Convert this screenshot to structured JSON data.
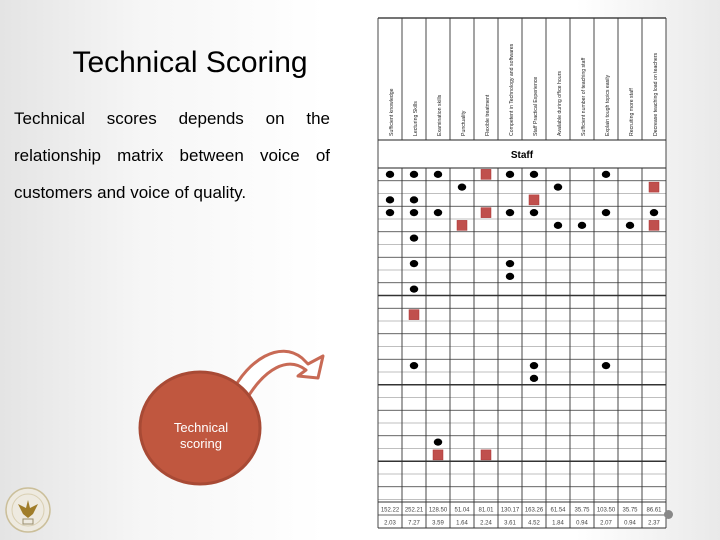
{
  "slide": {
    "title": "Technical Scoring",
    "body": "Technical scores depends on the relationship matrix between voice of customers and voice of quality.",
    "callout_label_line1": "Technical",
    "callout_label_line2": "scoring",
    "logo_icon": "university-seal-eagle-icon",
    "colors": {
      "callout_fill": "#c0573f",
      "callout_stroke": "#a84a35",
      "arrow_stroke": "#c86a55",
      "square_mark": "#c0504d",
      "dot_mark": "#000000"
    }
  },
  "matrix": {
    "group_label": "Staff",
    "columns": [
      "Sufficient knowledge",
      "Lecturing Skills",
      "Examination skills",
      "Punctuality",
      "Flexible treatment",
      "Competent in Technology and softwares",
      "Staff Practical Experience",
      "Available during office hours",
      "Sufficient number of teaching staff",
      "Explain tough topics easily",
      "Recruiting more staff",
      "Decrease teaching load on teachers"
    ],
    "row_count": 26,
    "marks": [
      {
        "row": 0,
        "col": 0,
        "type": "dot"
      },
      {
        "row": 0,
        "col": 1,
        "type": "dot"
      },
      {
        "row": 0,
        "col": 2,
        "type": "dot"
      },
      {
        "row": 0,
        "col": 4,
        "type": "square"
      },
      {
        "row": 0,
        "col": 5,
        "type": "dot"
      },
      {
        "row": 0,
        "col": 6,
        "type": "dot"
      },
      {
        "row": 0,
        "col": 9,
        "type": "dot"
      },
      {
        "row": 1,
        "col": 3,
        "type": "dot"
      },
      {
        "row": 1,
        "col": 7,
        "type": "dot"
      },
      {
        "row": 1,
        "col": 11,
        "type": "square"
      },
      {
        "row": 2,
        "col": 0,
        "type": "dot"
      },
      {
        "row": 2,
        "col": 1,
        "type": "dot"
      },
      {
        "row": 2,
        "col": 6,
        "type": "square"
      },
      {
        "row": 3,
        "col": 0,
        "type": "dot"
      },
      {
        "row": 3,
        "col": 1,
        "type": "dot"
      },
      {
        "row": 3,
        "col": 2,
        "type": "dot"
      },
      {
        "row": 3,
        "col": 4,
        "type": "square"
      },
      {
        "row": 3,
        "col": 5,
        "type": "dot"
      },
      {
        "row": 3,
        "col": 6,
        "type": "dot"
      },
      {
        "row": 3,
        "col": 9,
        "type": "dot"
      },
      {
        "row": 3,
        "col": 11,
        "type": "dot"
      },
      {
        "row": 4,
        "col": 3,
        "type": "square"
      },
      {
        "row": 4,
        "col": 7,
        "type": "dot"
      },
      {
        "row": 4,
        "col": 8,
        "type": "dot"
      },
      {
        "row": 4,
        "col": 10,
        "type": "dot"
      },
      {
        "row": 4,
        "col": 11,
        "type": "square"
      },
      {
        "row": 5,
        "col": 1,
        "type": "dot"
      },
      {
        "row": 7,
        "col": 1,
        "type": "dot"
      },
      {
        "row": 7,
        "col": 5,
        "type": "dot"
      },
      {
        "row": 8,
        "col": 5,
        "type": "dot"
      },
      {
        "row": 9,
        "col": 1,
        "type": "dot"
      },
      {
        "row": 11,
        "col": 1,
        "type": "square"
      },
      {
        "row": 15,
        "col": 1,
        "type": "dot"
      },
      {
        "row": 15,
        "col": 6,
        "type": "dot"
      },
      {
        "row": 15,
        "col": 9,
        "type": "dot"
      },
      {
        "row": 16,
        "col": 6,
        "type": "dot"
      },
      {
        "row": 21,
        "col": 2,
        "type": "dot"
      },
      {
        "row": 22,
        "col": 2,
        "type": "square"
      },
      {
        "row": 22,
        "col": 4,
        "type": "square"
      }
    ],
    "totals_absolute": [
      "152.22",
      "252.21",
      "128.50",
      "51.04",
      "81.01",
      "130.17",
      "163.26",
      "61.54",
      "35.75",
      "103.50",
      "35.75",
      "86.61"
    ],
    "totals_relative": [
      "2.03",
      "7.27",
      "3.59",
      "1.64",
      "2.24",
      "3.61",
      "4.52",
      "1.84",
      "0.94",
      "2.07",
      "0.94",
      "2.37"
    ]
  }
}
